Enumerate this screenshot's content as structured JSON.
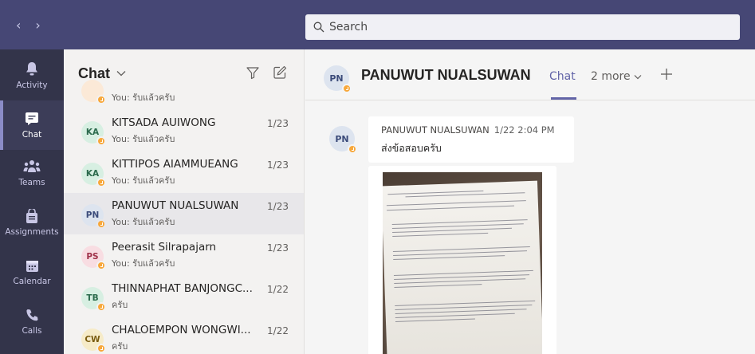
{
  "nav": {
    "back": "‹",
    "forward": "›"
  },
  "search": {
    "placeholder": "Search"
  },
  "rail": [
    {
      "label": "Activity",
      "icon": "bell-icon"
    },
    {
      "label": "Chat",
      "icon": "chat-icon",
      "active": true
    },
    {
      "label": "Teams",
      "icon": "teams-icon"
    },
    {
      "label": "Assignments",
      "icon": "assignments-icon"
    },
    {
      "label": "Calendar",
      "icon": "calendar-icon"
    },
    {
      "label": "Calls",
      "icon": "phone-icon"
    }
  ],
  "chat_panel": {
    "title": "Chat",
    "items": [
      {
        "initials": "",
        "name": "",
        "preview": "You: รับแล้วครับ",
        "date": "",
        "avatar_bg": "#fbe9d7",
        "avatar_fg": "#8a4a1a"
      },
      {
        "initials": "KA",
        "name": "KITSADA AUIWONG",
        "preview": "You: รับแล้วครับ",
        "date": "1/23",
        "avatar_bg": "#d7efe2",
        "avatar_fg": "#2c6b4d"
      },
      {
        "initials": "KA",
        "name": "KITTIPOS AIAMMUEANG",
        "preview": "You: รับแล้วครับ",
        "date": "1/23",
        "avatar_bg": "#d7efe2",
        "avatar_fg": "#2c6b4d"
      },
      {
        "initials": "PN",
        "name": "PANUWUT NUALSUWAN",
        "preview": "You: รับแล้วครับ",
        "date": "1/23",
        "avatar_bg": "#dde4ef",
        "avatar_fg": "#3b4b7a",
        "selected": true
      },
      {
        "initials": "PS",
        "name": "Peerasit Silrapajarn",
        "preview": "You: รับแล้วครับ",
        "date": "1/23",
        "avatar_bg": "#f8dde2",
        "avatar_fg": "#a0324a"
      },
      {
        "initials": "TB",
        "name": "THINNAPHAT BANJONGC...",
        "preview": "ครับ",
        "date": "1/22",
        "avatar_bg": "#d7efe2",
        "avatar_fg": "#2c6b4d"
      },
      {
        "initials": "CW",
        "name": "CHALOEMPON WONGWI...",
        "preview": "ครับ",
        "date": "1/22",
        "avatar_bg": "#f6ebc8",
        "avatar_fg": "#7a5c10"
      }
    ]
  },
  "conversation": {
    "initials": "PN",
    "title": "PANUWUT NUALSUWAN",
    "tab_active": "Chat",
    "tab_more": "2 more",
    "message": {
      "sender": "PANUWUT NUALSUWAN",
      "timestamp": "1/22 2:04 PM",
      "text": "ส่งข้อสอบครับ",
      "attachment": "handwritten-exam-photo"
    }
  },
  "colors": {
    "topbar": "#464775",
    "rail": "#33344a",
    "accent": "#6264a7",
    "status_away": "#f8a83b"
  }
}
